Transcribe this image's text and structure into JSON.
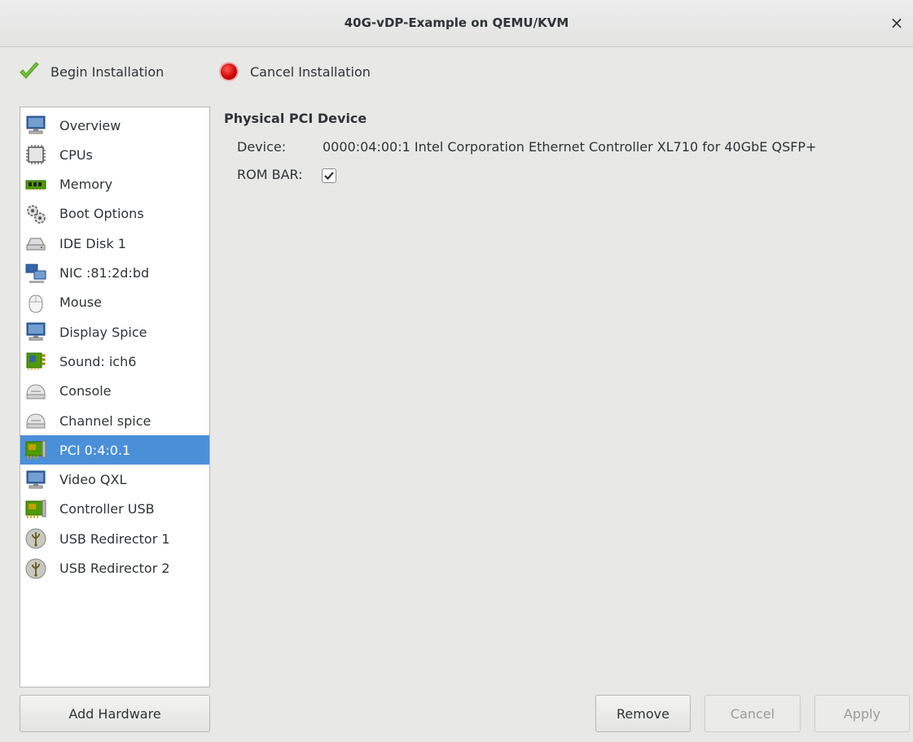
{
  "window": {
    "title": "40G-vDP-Example on QEMU/KVM",
    "close_glyph": "×"
  },
  "toolbar": {
    "begin_label": "Begin Installation",
    "begin_icon": "check-icon",
    "cancel_label": "Cancel Installation",
    "cancel_icon": "stop-icon"
  },
  "sidebar": {
    "items": [
      {
        "label": "Overview",
        "icon": "monitor-info-icon"
      },
      {
        "label": "CPUs",
        "icon": "cpu-icon"
      },
      {
        "label": "Memory",
        "icon": "memory-icon"
      },
      {
        "label": "Boot Options",
        "icon": "gears-icon"
      },
      {
        "label": "IDE Disk 1",
        "icon": "disk-icon"
      },
      {
        "label": "NIC :81:2d:bd",
        "icon": "network-icon"
      },
      {
        "label": "Mouse",
        "icon": "mouse-icon"
      },
      {
        "label": "Display Spice",
        "icon": "display-icon"
      },
      {
        "label": "Sound: ich6",
        "icon": "sound-card-icon"
      },
      {
        "label": "Console",
        "icon": "serial-icon"
      },
      {
        "label": "Channel spice",
        "icon": "serial-icon"
      },
      {
        "label": "PCI 0:4:0.1",
        "icon": "pci-card-icon",
        "selected": true
      },
      {
        "label": "Video QXL",
        "icon": "display-icon"
      },
      {
        "label": "Controller USB",
        "icon": "pci-card-icon"
      },
      {
        "label": "USB Redirector 1",
        "icon": "usb-icon"
      },
      {
        "label": "USB Redirector 2",
        "icon": "usb-icon"
      }
    ]
  },
  "details": {
    "section_title": "Physical PCI Device",
    "device_label": "Device:",
    "device_value": "0000:04:00:1 Intel Corporation Ethernet Controller XL710 for 40GbE QSFP+",
    "rom_bar_label": "ROM BAR:",
    "rom_bar_checked": true
  },
  "buttons": {
    "add_hardware": "Add Hardware",
    "remove": "Remove",
    "cancel": "Cancel",
    "apply": "Apply"
  },
  "colors": {
    "selection": "#4a90d9",
    "background": "#e8e8e7"
  }
}
